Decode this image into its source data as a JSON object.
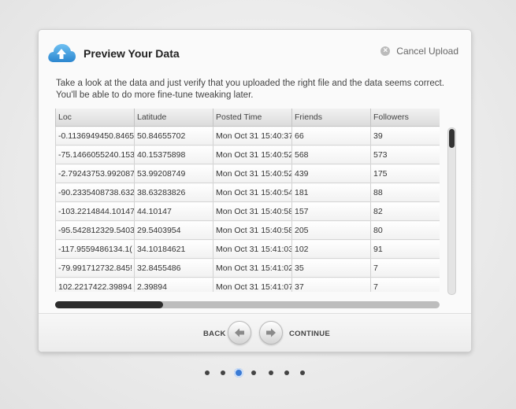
{
  "dialog": {
    "title": "Preview Your Data",
    "cancel_label": "Cancel Upload",
    "intro": "Take a look at the data and just verify that you uploaded the right file and the data seems correct. You'll be able to do more fine-tune tweaking later.",
    "icon": "cloud-upload-icon",
    "accent": "#3a9be0"
  },
  "table": {
    "columns": [
      "Loc",
      "Latitude",
      "Posted Time",
      "Friends",
      "Followers"
    ],
    "rows": [
      [
        "-0.1136949450.8465",
        "50.84655702",
        "Mon Oct 31 15:40:37",
        "66",
        "39"
      ],
      [
        "-75.1466055240.153",
        "40.15375898",
        "Mon Oct 31 15:40:52",
        "568",
        "573"
      ],
      [
        "-2.79243753.992087",
        "53.99208749",
        "Mon Oct 31 15:40:52",
        "439",
        "175"
      ],
      [
        "-90.2335408738.632",
        "38.63283826",
        "Mon Oct 31 15:40:54",
        "181",
        "88"
      ],
      [
        "-103.2214844.10147",
        "44.10147",
        "Mon Oct 31 15:40:58",
        "157",
        "82"
      ],
      [
        "-95.542812329.5403",
        "29.5403954",
        "Mon Oct 31 15:40:58",
        "205",
        "80"
      ],
      [
        "-117.9559486134.1(",
        "34.10184621",
        "Mon Oct 31 15:41:03",
        "102",
        "91"
      ],
      [
        "-79.991712732.845!",
        "32.8455486",
        "Mon Oct 31 15:41:02",
        "35",
        "7"
      ],
      [
        "102.2217422.39894",
        "2.39894",
        "Mon Oct 31 15:41:07",
        "37",
        "7"
      ]
    ]
  },
  "scroll": {
    "vertical_position": 0,
    "horizontal_position": 0
  },
  "footer": {
    "back_label": "BACK",
    "continue_label": "CONTINUE",
    "back_icon": "arrow-left-icon",
    "continue_icon": "arrow-right-icon"
  },
  "pagination": {
    "total": 7,
    "current": 3,
    "active_color": "#3a7bd5"
  }
}
